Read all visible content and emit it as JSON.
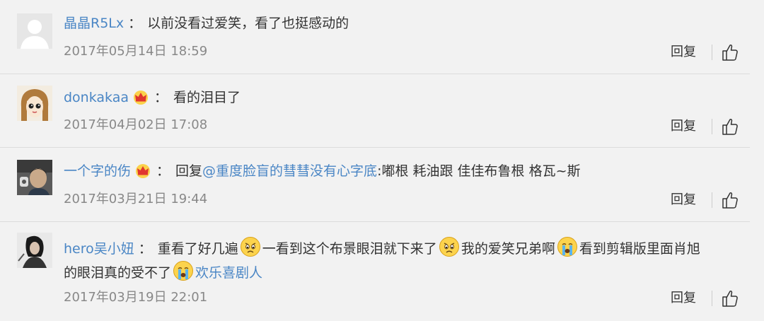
{
  "comments": [
    {
      "user": "晶晶R5Lx",
      "colon": "：",
      "text": "以前没看过爱笑，看了也挺感动的",
      "date": "2017年05月14日 18:59",
      "reply": "回复"
    },
    {
      "user": "donkakaa",
      "colon": "：",
      "text": "看的泪目了",
      "date": "2017年04月02日 17:08",
      "reply": "回复"
    },
    {
      "user": "一个字的伤",
      "colon": "：",
      "reply_prefix": "回复",
      "mention": "@重度脸盲的彗彗没有心字底",
      "text": ":嘟根 耗油跟 佳佳布鲁根 格瓦~斯",
      "date": "2017年03月21日 19:44",
      "reply": "回复"
    },
    {
      "user": "hero吴小妞",
      "colon": "：",
      "text_part1": "重看了好几遍",
      "text_part2": "一看到这个布景眼泪就下来了",
      "text_part3": "我的爱笑兄弟啊",
      "text_part4": "看到剪辑版里面肖旭",
      "text_part5": "的眼泪真的受不了",
      "tag": "欢乐喜剧人",
      "date": "2017年03月19日 22:01",
      "reply": "回复"
    }
  ],
  "colors": {
    "username": "#4a86c5",
    "date": "#888888",
    "background": "#f2f2f2",
    "divider": "#dcdcdc"
  },
  "icons": {
    "crown": "crown-icon",
    "like": "thumbs-up-icon",
    "sad": "sad-face-emoji",
    "cry": "crying-face-emoji"
  }
}
